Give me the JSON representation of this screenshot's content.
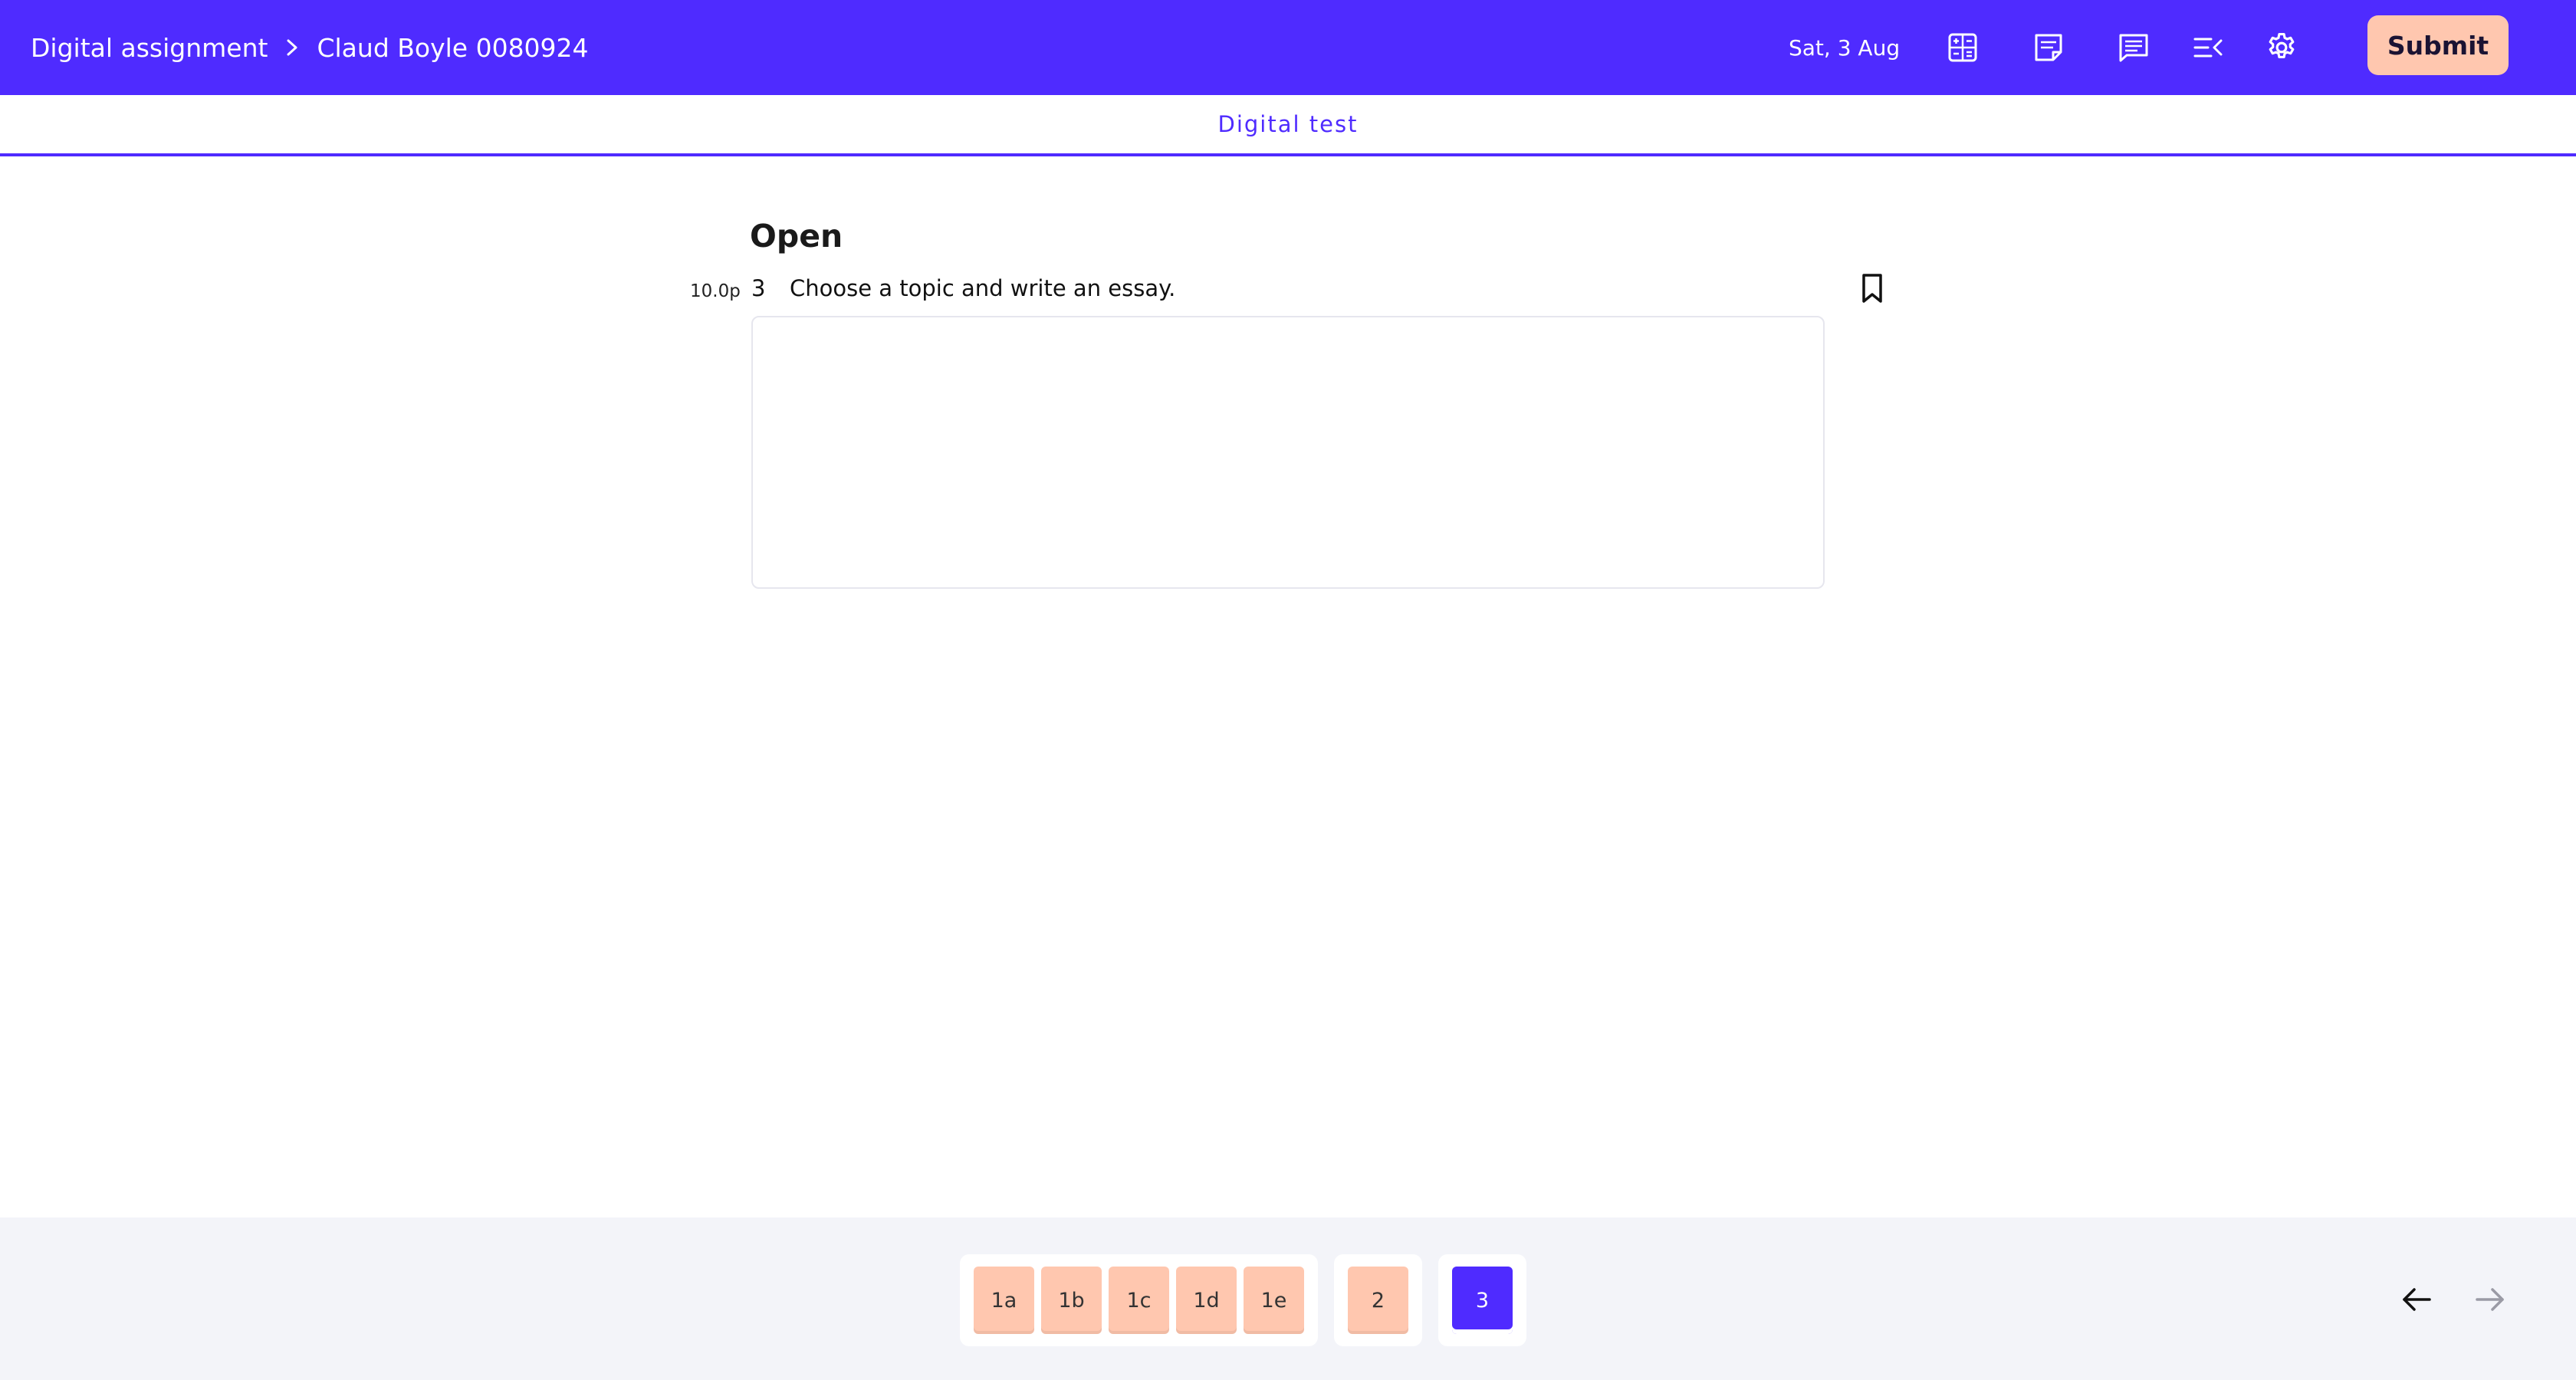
{
  "header": {
    "breadcrumb": [
      "Digital assignment",
      "Claud Boyle 0080924"
    ],
    "date": "Sat, 3 Aug",
    "icons": [
      "calculator-icon",
      "notes-icon",
      "comment-icon",
      "collapse-menu-icon",
      "gear-icon"
    ],
    "submit_label": "Submit"
  },
  "subheader": {
    "title": "Digital test"
  },
  "question": {
    "section_title": "Open",
    "points": "10.0p",
    "number": "3",
    "text": "Choose a topic and write an essay.",
    "answer_value": ""
  },
  "navigator": {
    "group1": [
      "1a",
      "1b",
      "1c",
      "1d",
      "1e"
    ],
    "group2": [
      "2"
    ],
    "group3": [
      "3"
    ],
    "active": "3",
    "prev_icon": "arrow-left-icon",
    "next_icon": "arrow-right-icon"
  },
  "colors": {
    "brand": "#4F2BFF",
    "accent": "#FFC7AF",
    "background_bottom": "#F3F4F9"
  }
}
